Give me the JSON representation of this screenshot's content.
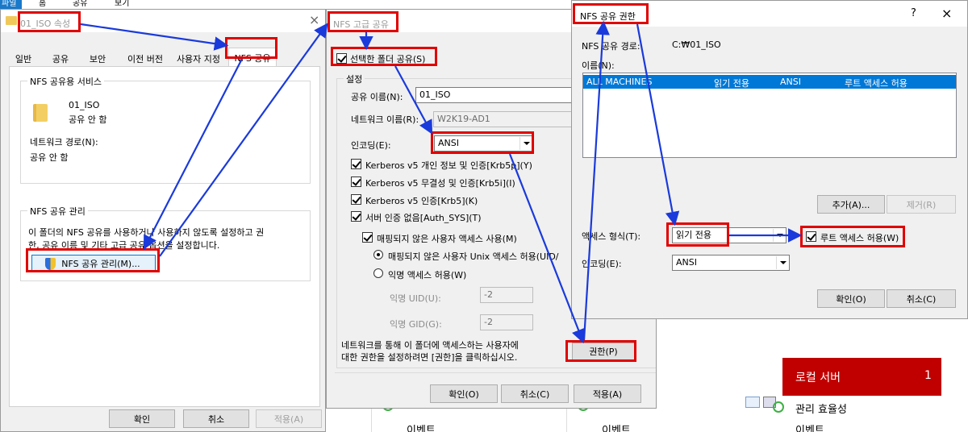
{
  "ribbon": {
    "file": "파일",
    "home": "홈",
    "share": "공유",
    "view": "보기"
  },
  "props": {
    "title": "01_ISO 속성",
    "close": "×",
    "tabs": [
      "일반",
      "공유",
      "보안",
      "이전 버전",
      "사용자 지정",
      "NFS 공유"
    ],
    "service_group": "NFS 공유용 서비스",
    "folder_name": "01_ISO",
    "folder_status": "공유 안 함",
    "network_path_label": "네트워크 경로(N):",
    "network_path_value": "공유 안 함",
    "manage_group": "NFS 공유 관리",
    "manage_desc_1": "이 폴더의 NFS 공유를 사용하거나 사용하지 않도록 설정하고 권",
    "manage_desc_2": "한, 공유 이름 및 기타 고급 공유 옵션을 설정합니다.",
    "manage_button": "NFS 공유 관리(M)...",
    "ok": "확인",
    "cancel": "취소",
    "apply": "적용(A)"
  },
  "advanced": {
    "title": "NFS 고급 공유",
    "share_checkbox": "선택한 폴더 공유(S)",
    "settings_group": "설정",
    "share_name_label": "공유 이름(N):",
    "share_name_value": "01_ISO",
    "network_name_label": "네트워크 이름(R):",
    "network_name_value": "W2K19-AD1",
    "encoding_label": "인코딩(E):",
    "encoding_value": "ANSI",
    "auth_options": [
      "Kerberos v5 개인 정보 및 인증[Krb5p](Y)",
      "Kerberos v5 무결성 및 인증[Krb5i](I)",
      "Kerberos v5 인증[Krb5](K)",
      "서버 인증 없음[Auth_SYS](T)"
    ],
    "unmapped_checkbox": "매핑되지 않은 사용자 액세스 사용(M)",
    "radio_unix": "매핑되지 않은 사용자 Unix 액세스 허용(UID/",
    "radio_anon": "익명 액세스 허용(W)",
    "anon_uid_label": "익명 UID(U):",
    "anon_uid_value": "-2",
    "anon_gid_label": "익명 GID(G):",
    "anon_gid_value": "-2",
    "perm_desc_1": "네트워크를 통해 이 폴더에 액세스하는 사용자에",
    "perm_desc_2": "대한 권한을 설정하려면 [권한]을 클릭하십시오.",
    "perm_button": "권한(P)",
    "ok": "확인(O)",
    "cancel": "취소(C)",
    "apply": "적용(A)"
  },
  "perms": {
    "title": "NFS 공유 권한",
    "help": "?",
    "close": "×",
    "path_label": "NFS 공유 경로:",
    "path_value": "C:₩01_ISO",
    "names_label": "이름(N):",
    "row": {
      "name": "ALL MACHINES",
      "access": "읽기 전용",
      "encoding": "ANSI",
      "root": "루트 액세스 허용"
    },
    "add": "추가(A)...",
    "remove": "제거(R)",
    "access_label": "액세스 형식(T):",
    "access_value": "읽기 전용",
    "root_checkbox": "루트 액세스 허용(W)",
    "encoding_label": "인코딩(E):",
    "encoding_value": "ANSI",
    "ok": "확인(O)",
    "cancel": "취소(C)"
  },
  "server_manager": {
    "local_server": "로컬 서버",
    "local_server_count": "1",
    "manageability": "관리 효율성",
    "events_1": "이벤트",
    "events_2": "이벤트",
    "events_3": "이벤트"
  },
  "colors": {
    "highlight": "#e00000",
    "arrow": "#1a3adb",
    "selection": "#0078d7",
    "server_red": "#c00000"
  }
}
